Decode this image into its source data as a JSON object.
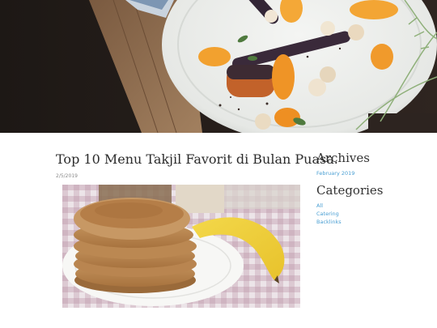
{
  "hero": {
    "image": "food-plate-photo",
    "colors": {
      "table": "#2a211c",
      "wood": "#8a6a4e",
      "plate": "#eef0ee",
      "orange": "#f09a2c"
    }
  },
  "post": {
    "title": "Top 10 Menu Takjil Favorit di Bulan Puasa.",
    "date": "2/5/2019",
    "image": "pancakes-banana-photo"
  },
  "sidebar": {
    "archives": {
      "title": "Archives",
      "items": [
        "February 2019"
      ]
    },
    "categories": {
      "title": "Categories",
      "items": [
        "All",
        "Catering",
        "Backlinks"
      ]
    }
  },
  "colors": {
    "link": "#4a9fd3",
    "title": "#2b2b2b"
  }
}
